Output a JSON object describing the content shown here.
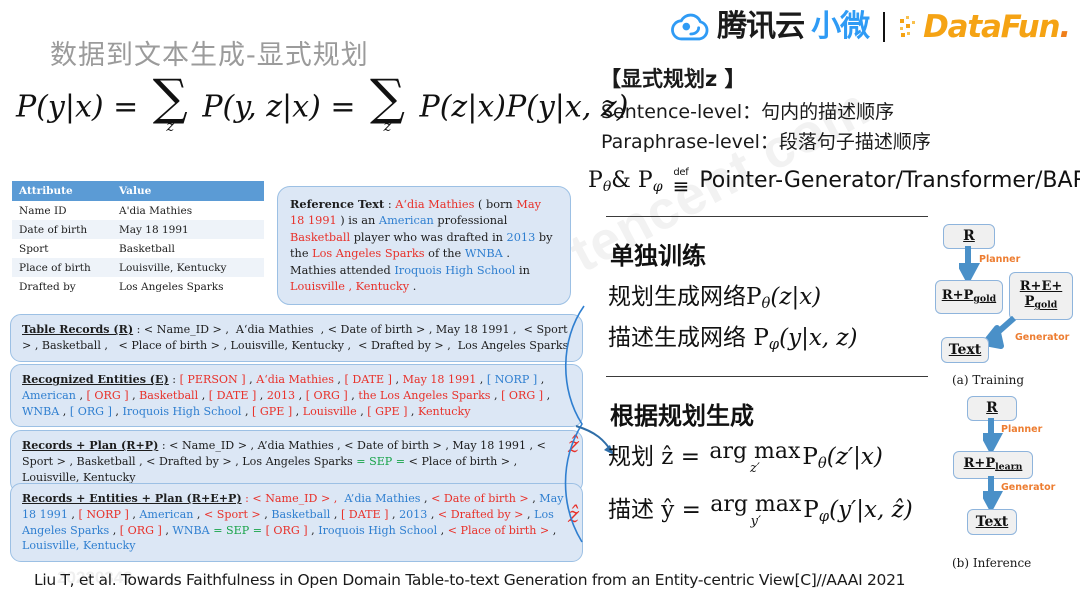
{
  "header": {
    "tencent_logo": {
      "icon": "cloud-icon",
      "text_black": "腾讯云",
      "text_blue": "小微",
      "brand_blue": "#2f9bf5"
    },
    "separator": "|",
    "datafun_logo": {
      "text": "DataFun",
      "dot": ".",
      "brand_orange": "#f5a314"
    }
  },
  "title": "数据到文本生成-显式规划",
  "master_equation": {
    "lhs": "P(y|x) =",
    "sum1_sub": "z",
    "term1": "P(y, z|x) =",
    "sum2_sub": "z",
    "term2": "P(z|x)P(y|x, z)"
  },
  "attribute_table": {
    "headers": [
      "Attribute",
      "Value"
    ],
    "rows": [
      [
        "Name ID",
        "A'dia Mathies"
      ],
      [
        "Date of birth",
        "May 18 1991"
      ],
      [
        "Sport",
        "Basketball"
      ],
      [
        "Place of birth",
        "Louisville, Kentucky"
      ],
      [
        "Drafted by",
        "Los Angeles Sparks"
      ]
    ],
    "header_bg": "#5b9bd5"
  },
  "reference_text": {
    "label": "Reference Text",
    "body": "A'dia Mathies ( born May 18 1991 ) is an American professional Basketball player who was drafted in 2013 by the Los Angeles Sparks of the WNBA . Mathies attended Iroquois High School in Louisville , Kentucky ."
  },
  "record_boxes": [
    {
      "id": "table-records",
      "label": "Table Records (R)",
      "body": ": < Name_ID > ,  A'dia Mathies  , < Date of birth > , May 18 1991 ,  < Sport > , Basketball ,   < Place of birth > , Louisville, Kentucky ,  < Drafted by > ,  Los Angeles Sparks"
    },
    {
      "id": "recognized-entities",
      "label": "Recognized Entities (E)",
      "body": ": [ PERSON ] , A'dia Mathies , [ DATE ] , May 18 1991 , [ NORP ] , American , [ ORG ] , Basketball , [ DATE ] , 2013 , [ ORG ] , the Los Angeles Sparks , [ ORG ] , WNBA , [ ORG ] , Iroquois High School , [ GPE ] , Louisville , [ GPE ] , Kentucky"
    },
    {
      "id": "records-plus-plan",
      "label": "Records + Plan (R+P)",
      "body": ": < Name_ID > , A'dia Mathies , < Date of birth > , May 18 1991 , < Sport > , Basketball , < Drafted by > , Los Angeles Sparks = SEP = < Place of birth > , Louisville, Kentucky"
    },
    {
      "id": "records-entities-plan",
      "label": "Records + Entities + Plan (R+E+P)",
      "body": ": < Name_ID > ,  A'dia Mathies , < Date of birth > , May 18 1991 , [ NORP ] , American , < Sport > , Basketball , [ DATE ] , 2013 , < Drafted by > , Los Angeles Sparks , [ ORG ] , WNBA = SEP = [ ORG ] , Iroquois High School , < Place of birth > , Louisville, Kentucky"
    }
  ],
  "plan_annotations": {
    "z_hat_1": "ẑ",
    "z_hat_2": "ẑ"
  },
  "right_panel": {
    "heading": "【显式规划z 】",
    "sentence_level": "Sentence-level：句内的描述顺序",
    "paraphrase_level": "Paraphrase-level：段落句子描述顺序",
    "definition": {
      "lhs_p1": "P",
      "lhs_sub1": "θ",
      "amp": "&",
      "lhs_p2": "P",
      "lhs_sub2": "φ",
      "def_label": "def",
      "def_sign": "=",
      "rhs": "Pointer-Generator/Transformer/BART"
    },
    "training": {
      "heading": "单独训练",
      "line1_prefix": "规划生成网络",
      "line1_eq": "P",
      "line1_sub": "θ",
      "line1_args": "(z|x)",
      "line2_prefix": "描述生成网络 ",
      "line2_eq": "P",
      "line2_sub": "φ",
      "line2_args": "(y|x, z)"
    },
    "inference": {
      "heading": "根据规划生成",
      "line1_prefix": "规划 ẑ =",
      "line1_argmax": "arg max",
      "line1_sub": "z′",
      "line1_eq": "P",
      "line1_eq_sub": "θ",
      "line1_args": "(z′|x)",
      "line2_prefix": "描述 ŷ =",
      "line2_argmax": "arg max",
      "line2_sub": "y′",
      "line2_eq": "P",
      "line2_eq_sub": "φ",
      "line2_args": "(y′|x, ẑ)"
    }
  },
  "flow_training": {
    "caption": "(a) Training",
    "nodes": [
      {
        "text": "R"
      },
      {
        "text": "R+P",
        "sub": "gold"
      },
      {
        "text": "R+E+",
        "line2": "P",
        "line2_sub": "gold"
      },
      {
        "text": "Text"
      }
    ],
    "arrow_labels": [
      "Planner",
      "Generator"
    ],
    "arrow_color": "#4a90c8",
    "label_color": "#ed7d31"
  },
  "flow_inference": {
    "caption": "(b) Inference",
    "nodes": [
      {
        "text": "R"
      },
      {
        "text": "R+P",
        "sub": "learn"
      },
      {
        "text": "Text"
      }
    ],
    "arrow_labels": [
      "Planner",
      "Generator"
    ],
    "arrow_color": "#4a90c8",
    "label_color": "#ed7d31"
  },
  "watermarks": {
    "diagonal": "tencent com",
    "date": "20220342"
  },
  "footer": "Liu T, et al. Towards Faithfulness in Open Domain Table-to-text Generation from an Entity-centric View[C]//AAAI 2021"
}
